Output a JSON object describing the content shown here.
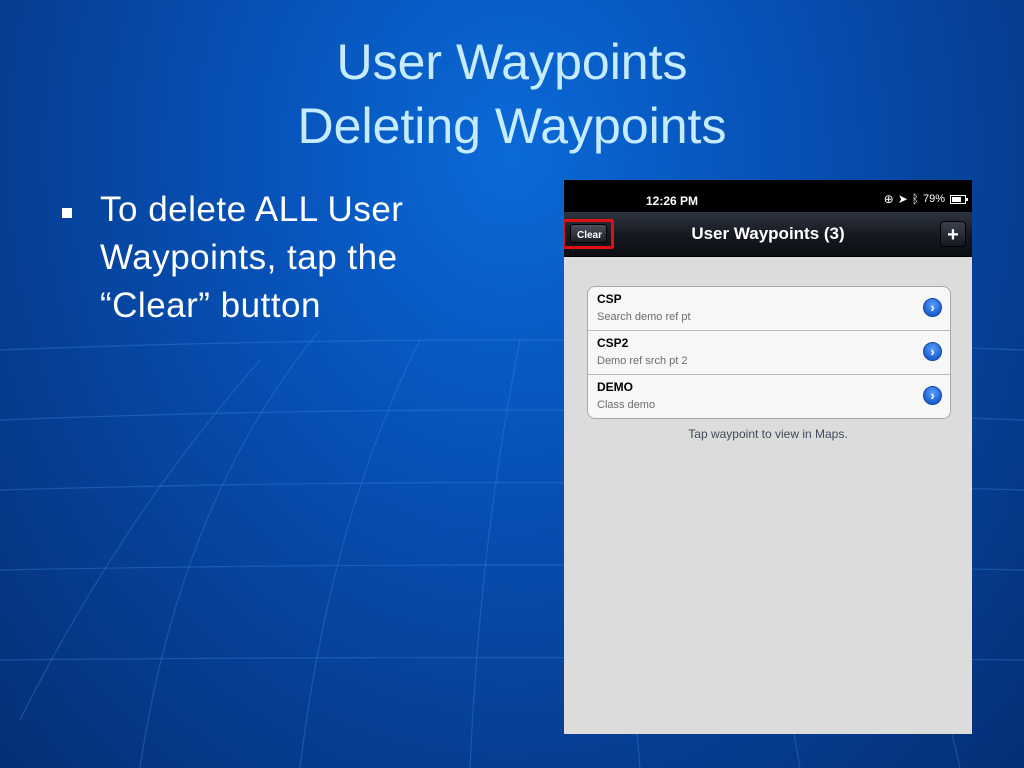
{
  "slide": {
    "title_line1": "User Waypoints",
    "title_line2": "Deleting Waypoints",
    "bullet_text": "To delete ALL User Waypoints, tap the “Clear” button"
  },
  "phone": {
    "status": {
      "time": "12:26 PM",
      "battery": "79%",
      "icons": [
        "lock-rotation-icon",
        "location-arrow-icon",
        "bluetooth-icon",
        "battery-icon"
      ]
    },
    "nav": {
      "clear_label": "Clear",
      "title": "User Waypoints (3)",
      "add_label": "+"
    },
    "waypoints": [
      {
        "name": "CSP",
        "description": "Search demo ref pt"
      },
      {
        "name": "CSP2",
        "description": "Demo ref srch pt 2"
      },
      {
        "name": "DEMO",
        "description": "Class demo"
      }
    ],
    "footer_note": "Tap waypoint to view in Maps."
  },
  "colors": {
    "title": "#c8ecff",
    "highlight": "#e01010",
    "disclosure": "#1c5fd0"
  }
}
